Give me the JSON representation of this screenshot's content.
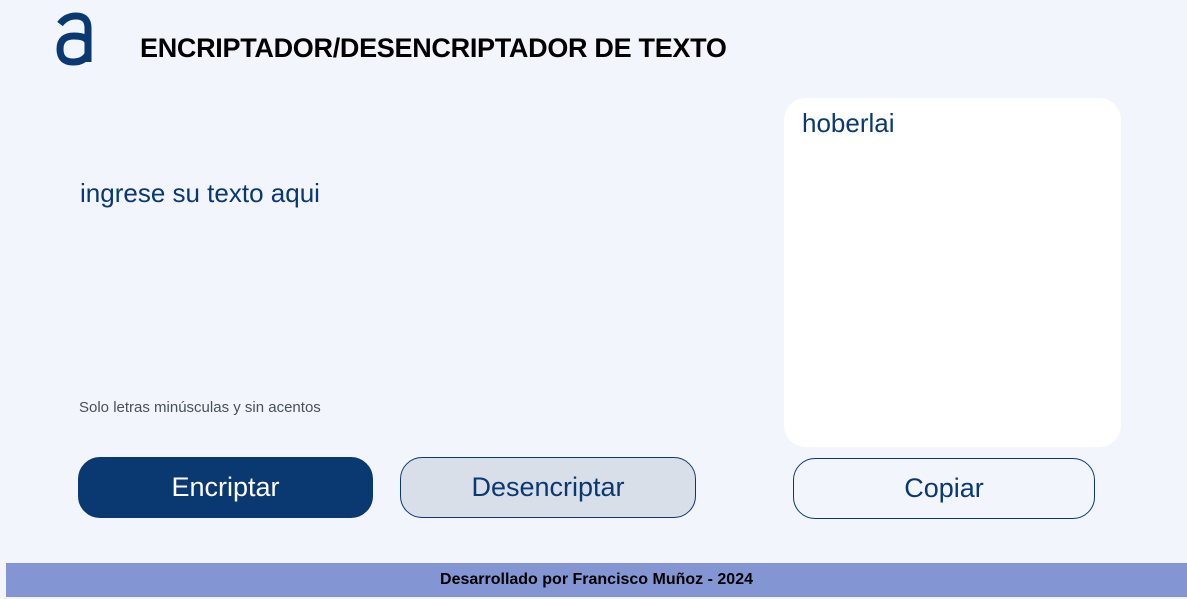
{
  "header": {
    "logo_icon": "alura-a-logo-icon",
    "title": "ENCRIPTADOR/DESENCRIPTADOR DE TEXTO"
  },
  "input": {
    "placeholder": "ingrese su texto aqui",
    "value": ""
  },
  "hint": {
    "text": "Solo letras minúsculas y sin acentos"
  },
  "buttons": {
    "encrypt_label": "Encriptar",
    "decrypt_label": "Desencriptar",
    "copy_label": "Copiar"
  },
  "output": {
    "text": "hoberlai"
  },
  "footer": {
    "text": "Desarrollado por Francisco Muñoz - 2024"
  },
  "colors": {
    "background": "#f2f5fc",
    "primary": "#0a3871",
    "secondary_button": "#d8dfe8",
    "footer": "#8395d3"
  }
}
